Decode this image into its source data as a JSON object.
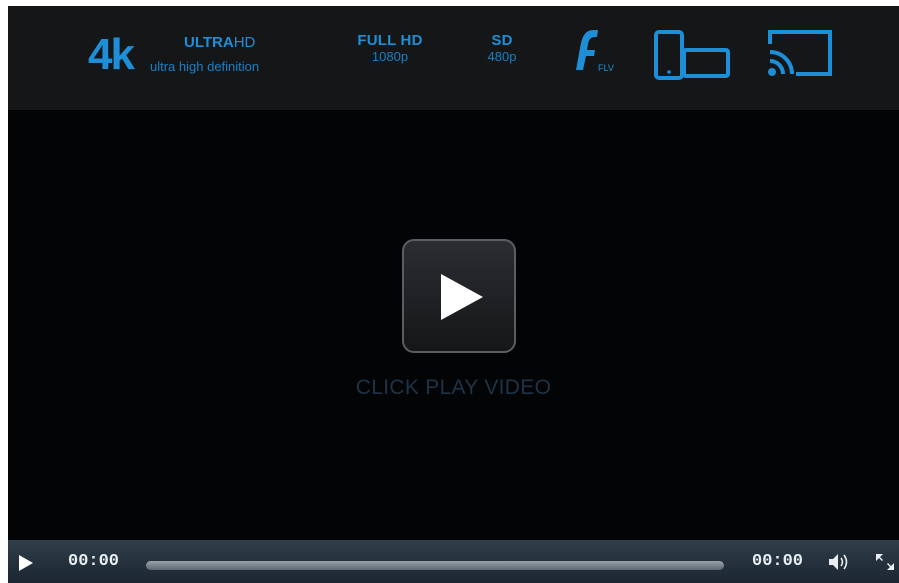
{
  "banner": {
    "fourk": {
      "big": "4k",
      "title_bold": "ULTRA",
      "title_light": "HD",
      "subtitle": "ultra high definition"
    },
    "fullhd": {
      "title": "FULL HD",
      "subtitle": "1080p"
    },
    "sd": {
      "title": "SD",
      "subtitle": "480p"
    },
    "flash": {
      "icon": "flash-fl-icon",
      "label": "FLV"
    },
    "devices_icon": "phone-tablet-devices-icon",
    "cast_icon": "chromecast-icon"
  },
  "center": {
    "play_icon": "play-icon",
    "label": "CLICK PLAY VIDEO"
  },
  "controls": {
    "current_time": "00:00",
    "total_time": "00:00",
    "progress": 0,
    "play_icon": "play-icon",
    "volume_icon": "volume-icon",
    "fullscreen_icon": "fullscreen-icon"
  },
  "colors": {
    "accent": "#1e8fd6",
    "player_bg": "#030406",
    "banner_bg": "#151618",
    "control_bar": "#263540"
  }
}
